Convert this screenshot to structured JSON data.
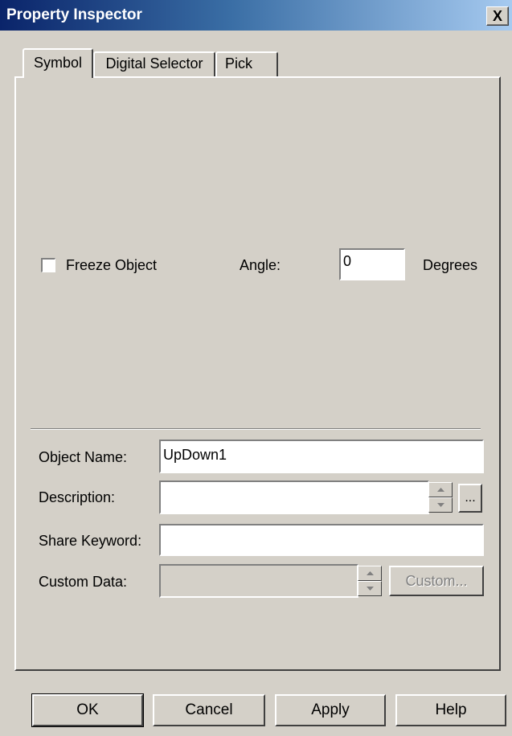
{
  "window": {
    "title": "Property Inspector",
    "close_glyph": "X"
  },
  "tabs": [
    {
      "label": "Symbol",
      "active": true
    },
    {
      "label": "Digital Selector",
      "active": false
    },
    {
      "label": "Pick",
      "active": false
    }
  ],
  "symbol": {
    "freeze_label": "Freeze Object",
    "freeze_checked": false,
    "angle_label": "Angle:",
    "angle_value": "0",
    "degrees_label": "Degrees"
  },
  "fields": {
    "object_name": {
      "label": "Object Name:",
      "value": "UpDown1"
    },
    "description": {
      "label": "Description:",
      "value": "",
      "browse_label": "..."
    },
    "share_keyword": {
      "label": "Share Keyword:",
      "value": ""
    },
    "custom_data": {
      "label": "Custom Data:",
      "value": "",
      "button_label": "Custom..."
    }
  },
  "buttons": {
    "ok": "OK",
    "cancel": "Cancel",
    "apply": "Apply",
    "help": "Help"
  },
  "icons": {
    "close": "close-icon",
    "spin_up": "up-arrow-icon",
    "spin_down": "down-arrow-icon"
  }
}
